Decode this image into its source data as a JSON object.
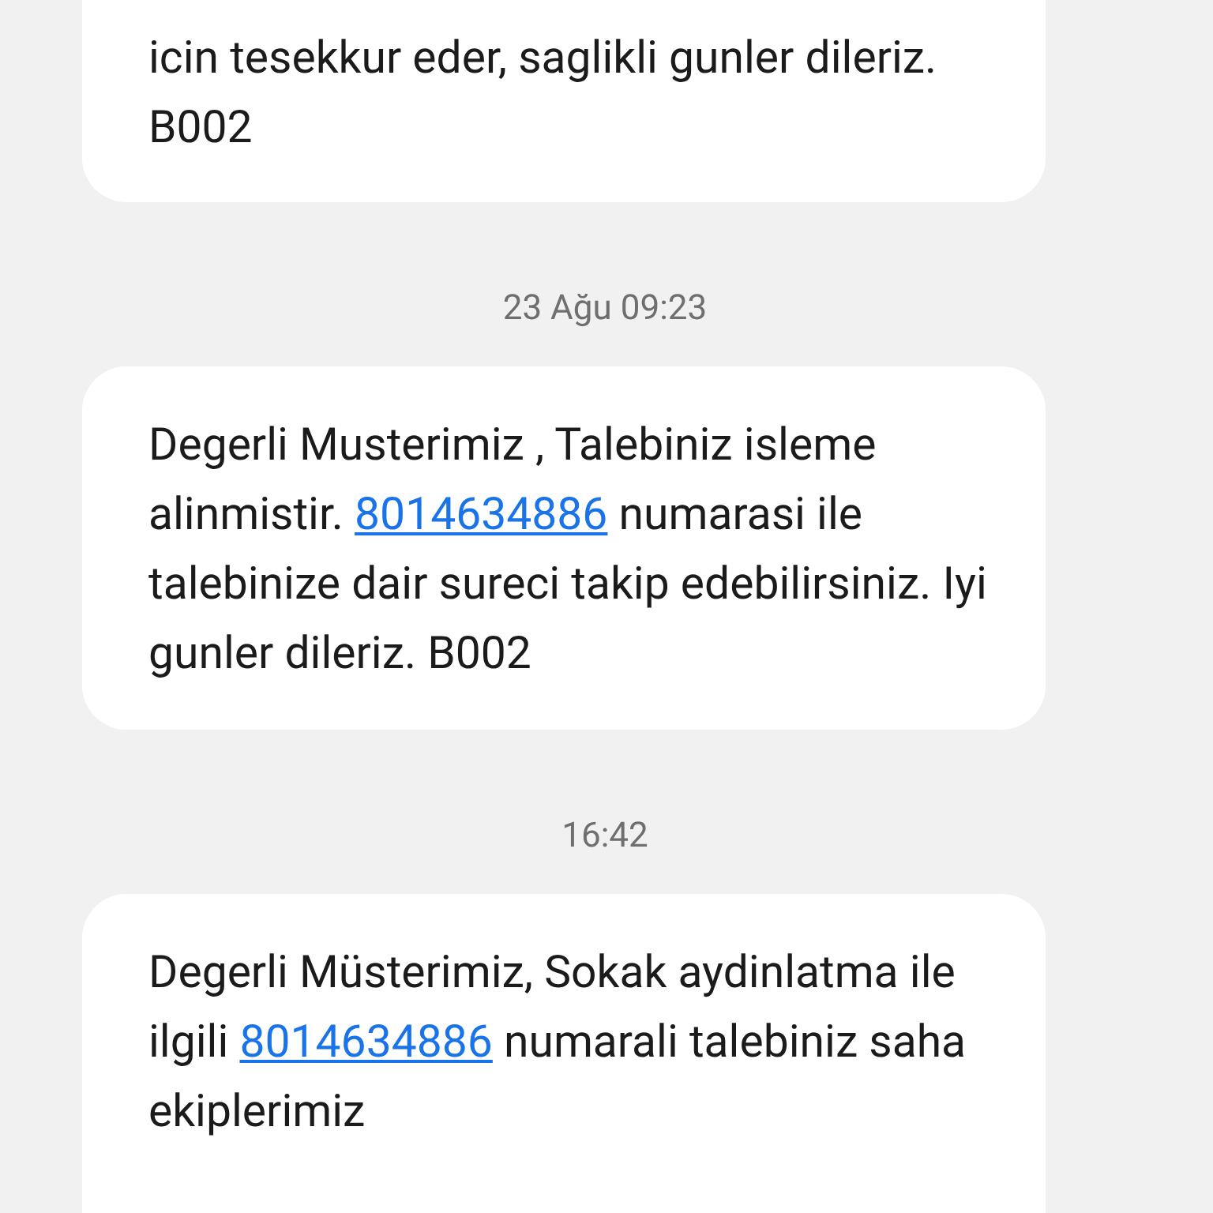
{
  "messages": [
    {
      "kind": "message",
      "segments": [
        {
          "kind": "text",
          "text": "icin tesekkur eder, saglikli gunler dileriz. B002"
        }
      ]
    },
    {
      "kind": "time",
      "text": "23 Ağu 09:23"
    },
    {
      "kind": "message",
      "segments": [
        {
          "kind": "text",
          "text": "Degerli Musterimiz , Talebiniz isleme alinmistir. "
        },
        {
          "kind": "link",
          "text": "8014634886"
        },
        {
          "kind": "text",
          "text": " numarasi ile talebinize dair sureci takip edebilirsiniz. Iyi gunler dileriz. B002"
        }
      ]
    },
    {
      "kind": "time",
      "text": "16:42"
    },
    {
      "kind": "message",
      "segments": [
        {
          "kind": "text",
          "text": "Degerli Müsterimiz, Sokak aydinlatma ile ilgili "
        },
        {
          "kind": "link",
          "text": "8014634886"
        },
        {
          "kind": "text",
          "text": " numarali talebiniz saha ekiplerimiz"
        }
      ]
    }
  ]
}
